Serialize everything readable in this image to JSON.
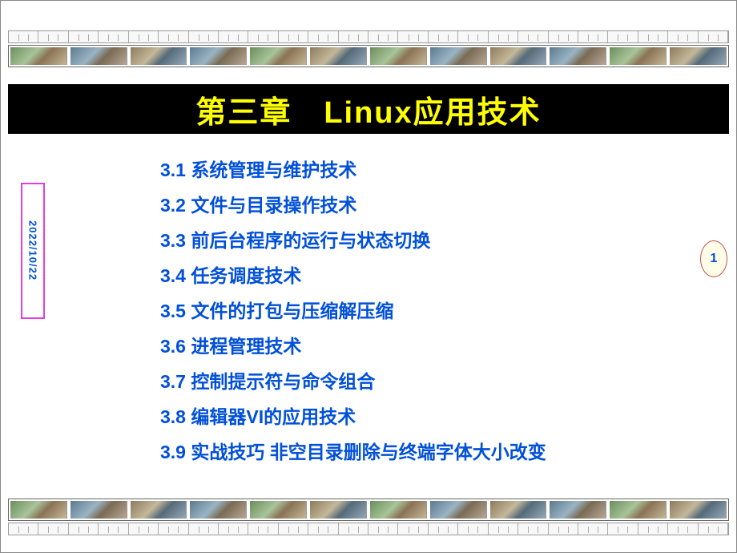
{
  "header": {
    "title": "第三章　Linux应用技术"
  },
  "date": "2022/10/22",
  "page_number": "1",
  "toc": {
    "items": [
      "3.1 系统管理与维护技术",
      "3.2 文件与目录操作技术",
      "3.3 前后台程序的运行与状态切换",
      "3.4 任务调度技术",
      "3.5 文件的打包与压缩解压缩",
      "3.6 进程管理技术",
      "3.7 控制提示符与命令组合",
      "3.8 编辑器VI的应用技术",
      "3.9 实战技巧 非空目录删除与终端字体大小改变"
    ]
  }
}
